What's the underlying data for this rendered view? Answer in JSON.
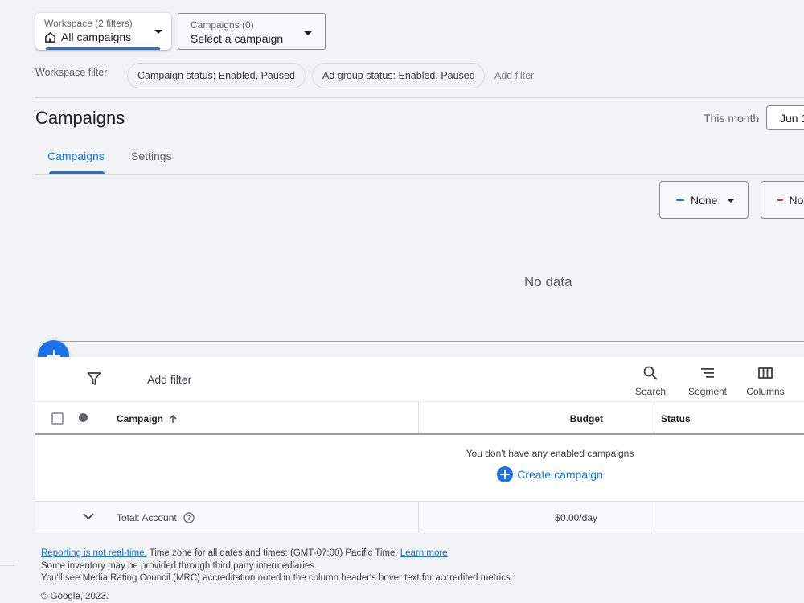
{
  "workspace": {
    "label": "Workspace (2 filters)",
    "value": "All campaigns"
  },
  "campaign_selector": {
    "label": "Campaigns (0)",
    "value": "Select a campaign"
  },
  "workspace_filter": {
    "label": "Workspace filter",
    "chips": [
      "Campaign status: Enabled, Paused",
      "Ad group status: Enabled, Paused"
    ],
    "add_filter": "Add filter"
  },
  "page": {
    "title": "Campaigns",
    "date_range_label": "This month",
    "date_range_value": "Jun 1"
  },
  "tabs": [
    {
      "label": "Campaigns",
      "active": true
    },
    {
      "label": "Settings",
      "active": false
    }
  ],
  "chart": {
    "metric1": {
      "label": "None",
      "color": "#1a73e8"
    },
    "metric2": {
      "label": "None",
      "color": "#d93025"
    },
    "empty": "No data"
  },
  "table": {
    "add_filter": "Add filter",
    "toolbar": {
      "search": "Search",
      "segment": "Segment",
      "columns": "Columns"
    },
    "headers": {
      "campaign": "Campaign",
      "budget": "Budget",
      "status": "Status"
    },
    "empty_message": "You don't have any enabled campaigns",
    "create_label": "Create campaign",
    "total": {
      "label": "Total: Account",
      "budget": "$0.00/day"
    }
  },
  "footer": {
    "link1": "Reporting is not real-time.",
    "text1": " Time zone for all dates and times: (GMT-07:00) Pacific Time. ",
    "link2": "Learn more",
    "line2": "Some inventory may be provided through third party intermediaries.",
    "line3": "You'll see Media Rating Council (MRC) accreditation noted in the column header's hover text for accredited metrics.",
    "copyright": "© Google, 2023."
  },
  "colors": {
    "accent": "#1a73e8",
    "metric_red": "#d93025"
  }
}
